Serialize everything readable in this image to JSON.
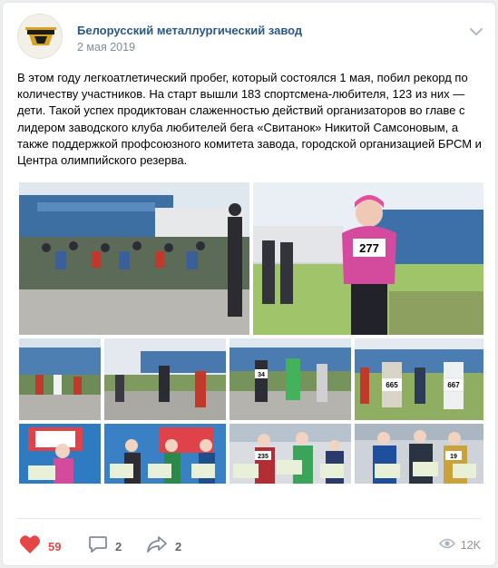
{
  "post": {
    "author": "Белорусский металлургический завод",
    "date": "2 мая 2019",
    "text": "В этом году легкоатлетический пробег, который состоялся 1 мая, побил рекорд по количеству участников. На старт вышли 183 спортсмена-любителя, 123 из них — дети. Такой успех продиктован слаженностью действий организаторов во главе с лидером заводского клуба любителей бега «Свитанок» Никитой Самсоновым, а также поддержкой профсоюзного комитета завода, городской организацией БРСМ и Центра олимпийского резерва."
  },
  "bib_numbers": {
    "girl_large": "277",
    "runner_center": "34",
    "runner_right": "665",
    "runner_far": "667",
    "kid_award": "235",
    "boy_award": "19"
  },
  "footer": {
    "likes": "59",
    "comments": "2",
    "shares": "2",
    "views": "12K"
  },
  "colors": {
    "link": "#2a5885",
    "like": "#e64646",
    "muted": "#818c99"
  },
  "icons": [
    "menu-chevron-icon",
    "heart-icon",
    "comment-icon",
    "share-icon",
    "eye-icon"
  ]
}
